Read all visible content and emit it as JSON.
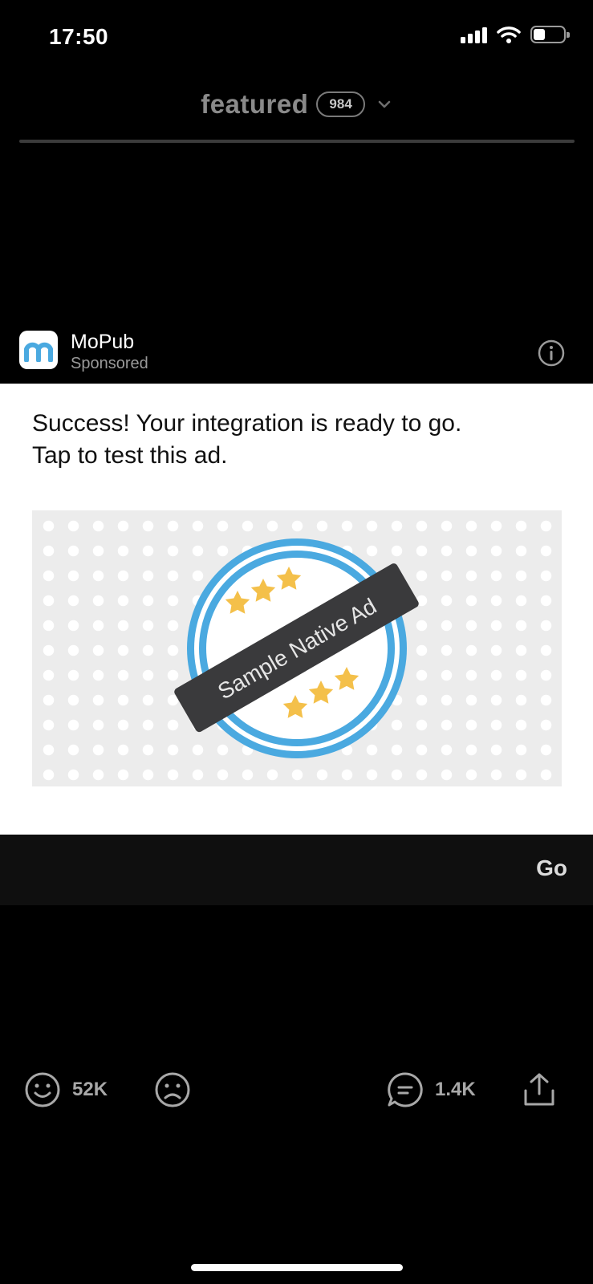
{
  "status_bar": {
    "time": "17:50"
  },
  "header": {
    "title": "featured",
    "count": "984"
  },
  "ad": {
    "brand": "MoPub",
    "sponsored_label": "Sponsored",
    "text_line1": "Success! Your integration is ready to go.",
    "text_line2": "Tap to test this ad.",
    "image_label": "Sample Native Ad",
    "cta_label": "Go"
  },
  "actions": {
    "likes_count": "52K",
    "comments_count": "1.4K"
  },
  "colors": {
    "background": "#000000",
    "mopub_blue": "#4aa9e0",
    "star_gold": "#f4c04a",
    "banner_dark": "#3a3a3c"
  },
  "icons": [
    "signal-icon",
    "wifi-icon",
    "battery-icon",
    "chevron-down-icon",
    "mopub-logo-icon",
    "info-icon",
    "smile-icon",
    "frown-icon",
    "comment-icon",
    "share-icon"
  ]
}
